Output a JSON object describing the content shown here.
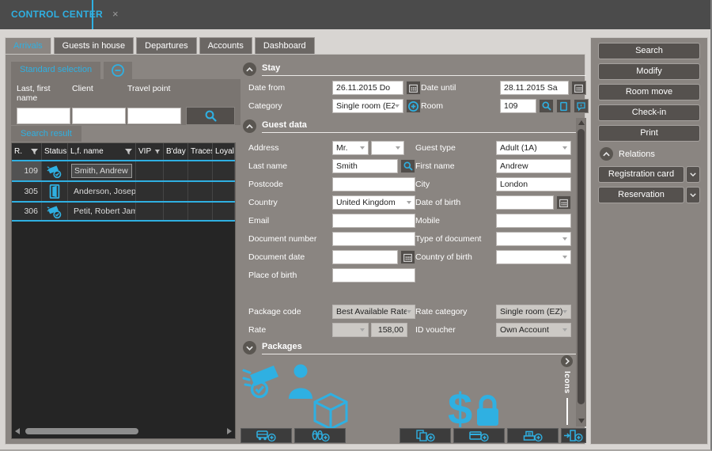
{
  "window": {
    "title": "CONTROL CENTER",
    "close_glyph": "×"
  },
  "tabs": [
    {
      "label": "Arrivals",
      "active": true
    },
    {
      "label": "Guests in house",
      "active": false
    },
    {
      "label": "Departures",
      "active": false
    },
    {
      "label": "Accounts",
      "active": false
    },
    {
      "label": "Dashboard",
      "active": false
    }
  ],
  "selection": {
    "tab_label": "Standard selection",
    "fields": [
      {
        "label": "Last, first name",
        "value": ""
      },
      {
        "label": "Client",
        "value": ""
      },
      {
        "label": "Travel point",
        "value": ""
      }
    ]
  },
  "results": {
    "tab_label": "Search result",
    "columns": [
      "R.",
      "Status",
      "L,f. name",
      "VIP",
      "B'day",
      "Traces",
      "Loyalty"
    ],
    "rows": [
      {
        "room": "109",
        "status_icon": "money-check-icon",
        "name": "Smith, Andrew",
        "selected": true
      },
      {
        "room": "305",
        "status_icon": "door-icon",
        "name": "Anderson, Josephine",
        "selected": false
      },
      {
        "room": "306",
        "status_icon": "money-check-icon",
        "name": "Petit, Robert James",
        "selected": false
      }
    ]
  },
  "stay": {
    "title": "Stay",
    "date_from_label": "Date from",
    "date_from_value": "26.11.2015 Do",
    "date_until_label": "Date until",
    "date_until_value": "28.11.2015 Sa",
    "category_label": "Category",
    "category_value": "Single room (EZ",
    "room_label": "Room",
    "room_value": "109"
  },
  "guest": {
    "title": "Guest data",
    "address_label": "Address",
    "salutation_value": "Mr.",
    "guest_type_label": "Guest type",
    "guest_type_value": "Adult (1A)",
    "last_name_label": "Last name",
    "last_name_value": "Smith",
    "first_name_label": "First name",
    "first_name_value": "Andrew",
    "postcode_label": "Postcode",
    "postcode_value": "",
    "city_label": "City",
    "city_value": "London",
    "country_label": "Country",
    "country_value": "United Kingdom",
    "date_of_birth_label": "Date of birth",
    "email_label": "Email",
    "mobile_label": "Mobile",
    "document_number_label": "Document number",
    "document_type_label": "Type of document",
    "document_date_label": "Document date",
    "country_of_birth_label": "Country of birth",
    "place_of_birth_label": "Place of birth"
  },
  "rate": {
    "package_code_label": "Package code",
    "package_code_value": "Best Available Rate",
    "rate_category_label": "Rate category",
    "rate_category_value": "Single room (EZ)",
    "rate_label": "Rate",
    "rate_value": "158,00",
    "id_voucher_label": "ID voucher",
    "id_voucher_value": "Own Account"
  },
  "packages": {
    "title": "Packages",
    "icons_rail_label": "Icons",
    "icon_names": [
      "money-check-icon",
      "guest-icon",
      "package-box-icon",
      "rate-lock-icon"
    ]
  },
  "toolbar": {
    "icon_names": [
      "shuttle-add-icon",
      "slippers-add-icon",
      "copy-add-icon",
      "card-add-icon",
      "terminal-add-icon",
      "checkout-add-icon"
    ]
  },
  "sidebar": {
    "buttons": [
      "Search",
      "Modify",
      "Room move",
      "Check-in",
      "Print"
    ],
    "relations_label": "Relations",
    "relation_buttons": [
      "Registration card",
      "Reservation"
    ]
  },
  "colors": {
    "accent": "#2fb0e2",
    "panel": "#8a8581",
    "titlebar": "#4b4b4b"
  }
}
